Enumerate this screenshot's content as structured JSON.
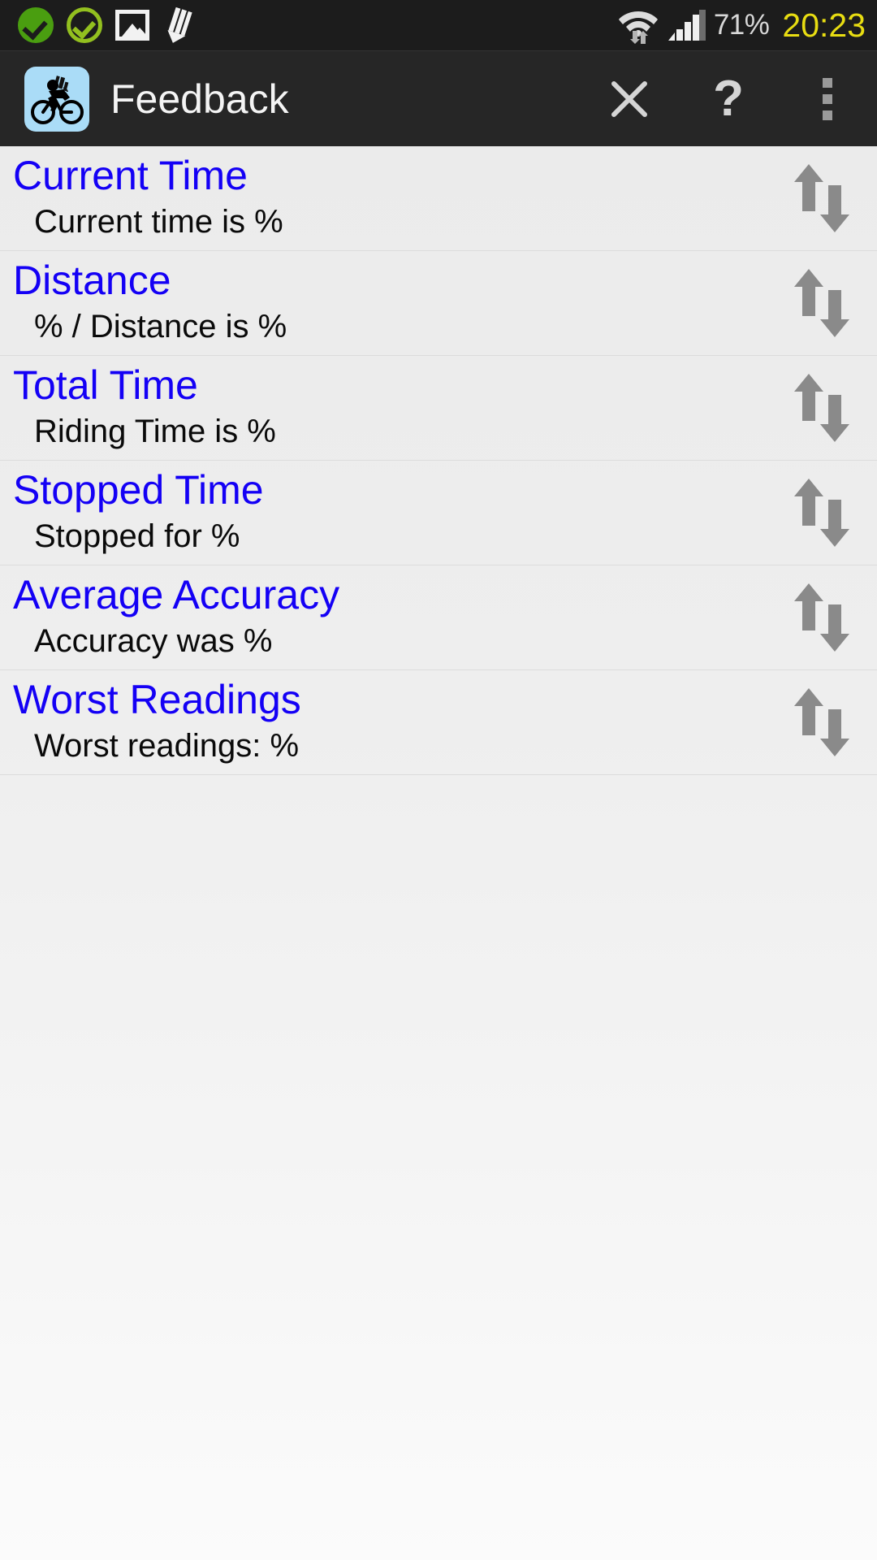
{
  "status_bar": {
    "icons": [
      {
        "name": "check-filled-icon",
        "label": "check-filled"
      },
      {
        "name": "check-outline-icon",
        "label": "check-outline"
      },
      {
        "name": "gallery-icon",
        "label": "gallery"
      },
      {
        "name": "pencil-icon",
        "label": "pencil"
      }
    ],
    "wifi_icon": "wifi-transfer-icon",
    "signal_icon": "cellular-signal-icon",
    "battery": "71%",
    "clock": "20:23",
    "colors": {
      "background": "#1c1c1c",
      "clock": "#e8dd12",
      "battery_text": "#d8d8d8",
      "check_filled": "#4a9e10",
      "check_outline": "#93c01f"
    }
  },
  "action_bar": {
    "app_icon": "cyclist-gps-app-icon",
    "title": "Feedback",
    "actions": [
      {
        "name": "close-button",
        "icon": "close-icon",
        "label": "Close"
      },
      {
        "name": "help-button",
        "icon": "question-mark-icon",
        "label": "?"
      },
      {
        "name": "overflow-button",
        "icon": "overflow-menu-icon",
        "label": "More options"
      }
    ],
    "colors": {
      "background": "#262626",
      "title": "#f4f4f4",
      "app_icon_bg": "#aadcf7"
    }
  },
  "list": {
    "drag_handle_icon": "reorder-up-down-arrows-icon",
    "colors": {
      "title": "#1400f5",
      "subtitle": "#0a0a0a",
      "divider": "#dcdcdc",
      "handle": "#8a8a8a"
    },
    "items": [
      {
        "title": "Current Time",
        "subtitle": "Current time is %"
      },
      {
        "title": "Distance",
        "subtitle": "% / Distance is %"
      },
      {
        "title": "Total Time",
        "subtitle": "Riding Time is %"
      },
      {
        "title": "Stopped Time",
        "subtitle": "Stopped for %"
      },
      {
        "title": "Average Accuracy",
        "subtitle": "Accuracy was %"
      },
      {
        "title": "Worst Readings",
        "subtitle": "Worst readings: %"
      }
    ]
  }
}
